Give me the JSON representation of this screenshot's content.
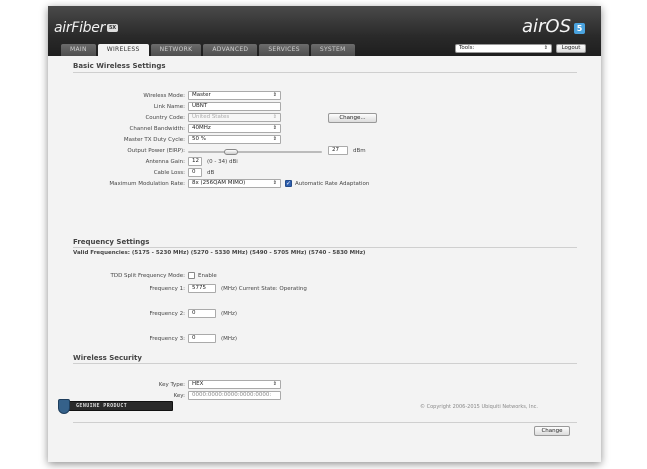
{
  "header": {
    "brand_left": "airFiber",
    "brand_left_badge": "5X",
    "brand_right": "airOS",
    "brand_right_badge": "5",
    "tabs": [
      "MAIN",
      "WIRELESS",
      "NETWORK",
      "ADVANCED",
      "SERVICES",
      "SYSTEM"
    ],
    "active_tab": "WIRELESS",
    "tools_value": "Tools:",
    "logout_label": "Logout"
  },
  "basic": {
    "title": "Basic Wireless Settings",
    "wireless_mode_label": "Wireless Mode:",
    "wireless_mode_value": "Master",
    "link_name_label": "Link Name:",
    "link_name_value": "UBNT",
    "country_code_label": "Country Code:",
    "country_code_value": "United States",
    "change_country_label": "Change...",
    "channel_bandwidth_label": "Channel Bandwidth:",
    "channel_bandwidth_value": "40MHz",
    "duty_cycle_label": "Master TX Duty Cycle:",
    "duty_cycle_value": "50 %",
    "output_power_label": "Output Power (EIRP):",
    "output_power_value": "27",
    "output_power_unit": "dBm",
    "output_power_level": 0.3,
    "antenna_gain_label": "Antenna Gain:",
    "antenna_gain_value": "12",
    "antenna_gain_range": "(0 - 34) dBi",
    "cable_loss_label": "Cable Loss:",
    "cable_loss_value": "0",
    "cable_loss_unit": "dB",
    "modulation_label": "Maximum Modulation Rate:",
    "modulation_value": "8x (256QAM MIMO)",
    "auto_rate_label": "Automatic Rate Adaptation",
    "auto_rate_checked": true
  },
  "frequency": {
    "title": "Frequency Settings",
    "valid_freqs": "Valid Frequencies: (5175 - 5230 MHz) (5270 - 5330 MHz) (5490 - 5705 MHz) (5740 - 5830 MHz)",
    "tdd_label": "TDD Split Frequency Mode:",
    "tdd_enable_label": "Enable",
    "tdd_enabled": false,
    "freq1_label": "Frequency 1:",
    "freq1_value": "5775",
    "freq1_unit": "(MHz) Current State: Operating",
    "freq2_label": "Frequency 2:",
    "freq2_value": "0",
    "freq2_unit": "(MHz)",
    "freq3_label": "Frequency 3:",
    "freq3_value": "0",
    "freq3_unit": "(MHz)"
  },
  "security": {
    "title": "Wireless Security",
    "key_type_label": "Key Type:",
    "key_type_value": "HEX",
    "key_label": "Key:",
    "key_value": "0000:0000:0000:0000:0000:"
  },
  "footer": {
    "change_label": "Change",
    "genuine_text": "GENUINE PRODUCT",
    "copyright": "© Copyright 2006-2015 Ubiquiti Networks, Inc."
  }
}
